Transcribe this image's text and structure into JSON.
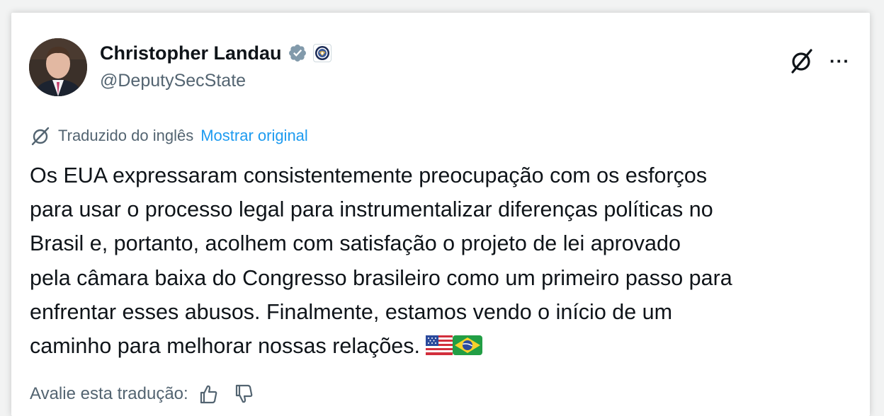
{
  "author": {
    "name": "Christopher Landau",
    "handle": "@DeputySecState"
  },
  "translation": {
    "label": "Traduzido do inglês",
    "show_original": "Mostrar original"
  },
  "tweet": {
    "lines": [
      "Os EUA expressaram consistentemente preocupação com os esforços",
      "para usar o processo legal para instrumentalizar diferenças políticas no",
      "Brasil e, portanto, acolhem com satisfação o projeto de lei aprovado",
      "pela câmara baixa do Congresso brasileiro como um primeiro passo para",
      "enfrentar esses abusos. Finalmente, estamos vendo o início de um",
      "caminho para melhorar nossas relações."
    ],
    "emojis": [
      "us-flag",
      "brazil-flag"
    ]
  },
  "rating": {
    "label": "Avalie esta tradução:"
  },
  "top_actions": {
    "more": "···"
  },
  "colors": {
    "text": "#0f1419",
    "secondary": "#536471",
    "link": "#1d9bf0",
    "verified": "#829aab"
  }
}
